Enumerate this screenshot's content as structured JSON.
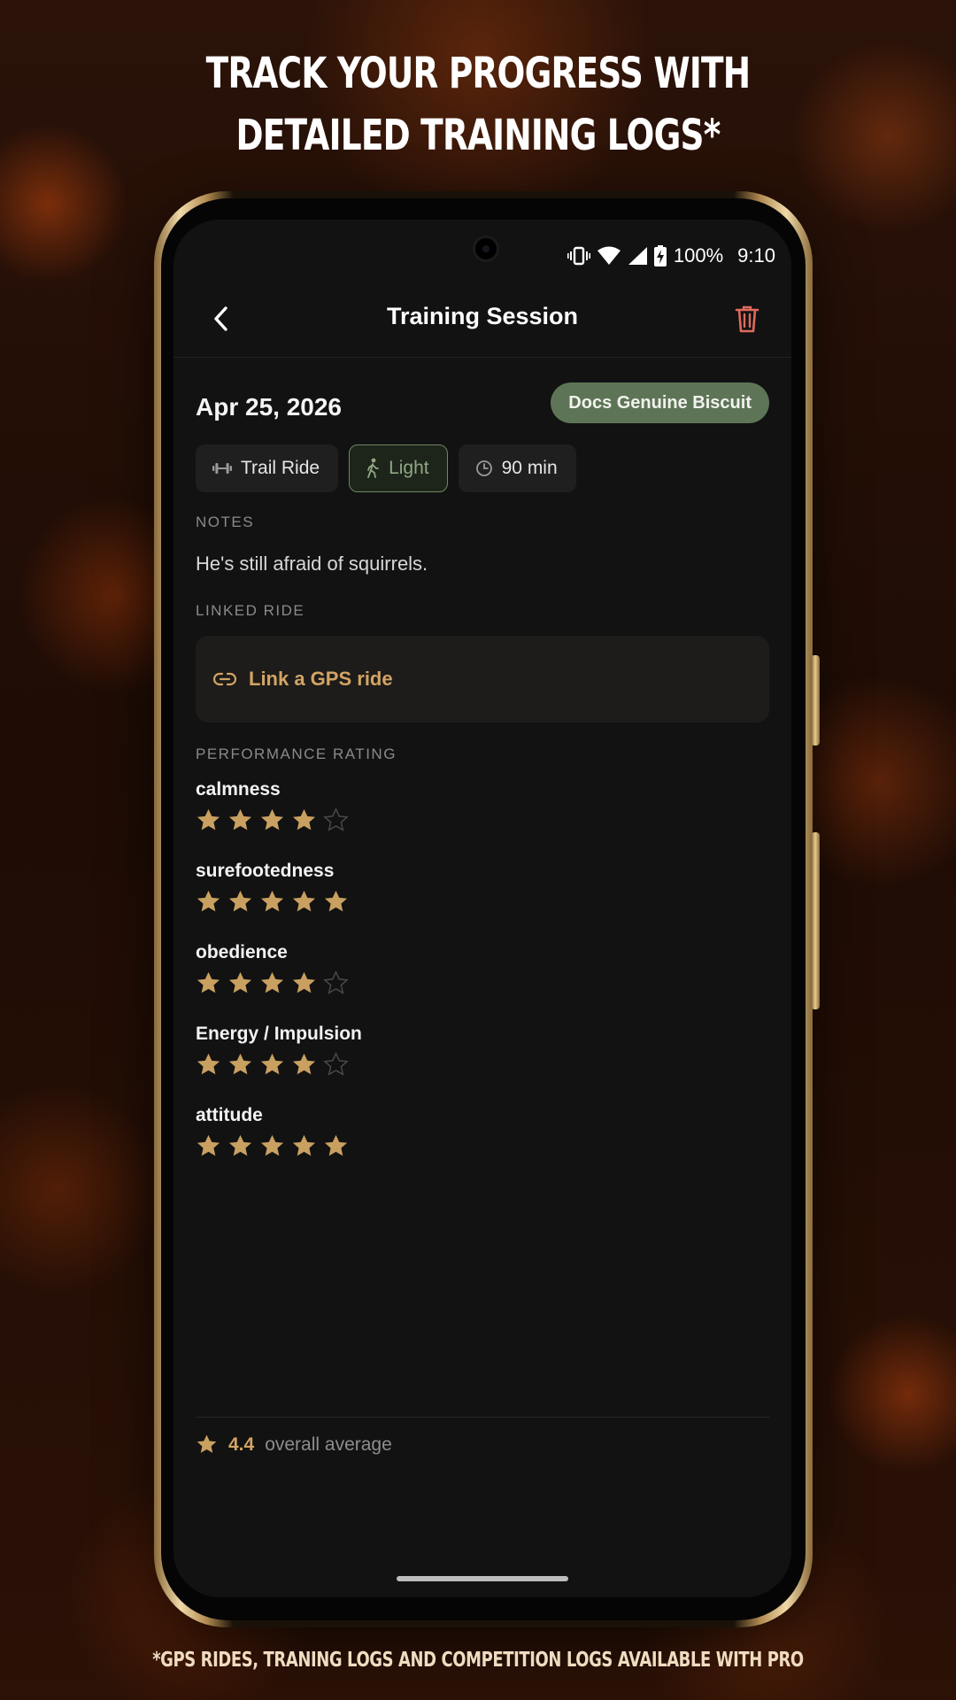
{
  "promo": {
    "headline_line1": "TRACK YOUR PROGRESS WITH",
    "headline_line2": "DETAILED TRAINING LOGS*",
    "footnote": "*GPS RIDES, TRANING LOGS AND COMPETITION LOGS AVAILABLE WITH PRO"
  },
  "status_bar": {
    "battery": "100%",
    "time": "9:10",
    "icons": [
      "vibrate-icon",
      "wifi-icon",
      "signal-icon",
      "battery-charging-icon"
    ]
  },
  "app_bar": {
    "title": "Training Session",
    "back_icon": "chevron-left-icon",
    "delete_icon": "trash-icon"
  },
  "session": {
    "date": "Apr 25, 2026",
    "horse": "Docs Genuine Biscuit",
    "chips": [
      {
        "icon": "dumbbell-icon",
        "label": "Trail Ride",
        "active": false
      },
      {
        "icon": "walk-icon",
        "label": "Light",
        "active": true
      },
      {
        "icon": "clock-icon",
        "label": "90 min",
        "active": false
      }
    ]
  },
  "notes": {
    "label": "NOTES",
    "text": "He's still afraid of squirrels."
  },
  "linked_ride": {
    "label": "LINKED RIDE",
    "action": "Link a GPS ride",
    "icon": "link-icon"
  },
  "performance": {
    "label": "PERFORMANCE RATING",
    "max_stars": 5,
    "ratings": [
      {
        "name": "calmness",
        "stars": 4
      },
      {
        "name": "surefootedness",
        "stars": 5
      },
      {
        "name": "obedience",
        "stars": 4
      },
      {
        "name": "Energy / Impulsion",
        "stars": 4
      },
      {
        "name": "attitude",
        "stars": 5
      }
    ],
    "average": "4.4",
    "average_label": "overall average"
  },
  "colors": {
    "accent_gold": "#d3a463",
    "star_filled": "#c9a060",
    "badge_green": "#5d7556",
    "delete_red": "#e06a5c",
    "background": "#121212"
  }
}
